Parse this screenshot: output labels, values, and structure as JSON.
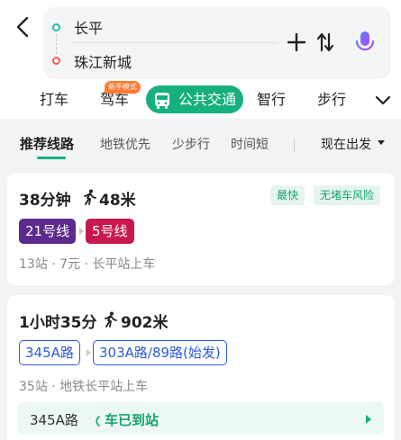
{
  "header": {
    "origin": "长平",
    "destination": "珠江新城"
  },
  "modes": {
    "taxi": "打车",
    "drive": "驾车",
    "drive_badge": "新手模式",
    "transit": "公共交通",
    "smart": "智行",
    "walk": "步行"
  },
  "filters": {
    "recommended": "推荐线路",
    "metro_first": "地铁优先",
    "less_walk": "少步行",
    "short_time": "时间短",
    "departure": "现在出发"
  },
  "routes": [
    {
      "duration": "38分钟",
      "walk": "48米",
      "tags": [
        "最快",
        "无堵车风险"
      ],
      "lines": [
        "21号线",
        "5号线"
      ],
      "info": "13站 · 7元 · 长平站上车"
    },
    {
      "duration": "1小时35分",
      "walk": "902米",
      "lines": [
        "345A路",
        "303A路/89路(始发)"
      ],
      "info": "35站 · 地铁长平站上车",
      "arrival": {
        "route": "345A路",
        "status": "车已到站"
      }
    }
  ],
  "colors": {
    "accent": "#16b07f",
    "line21": "#5c2a8e",
    "line5": "#c8184e",
    "bus": "#2a5bd7"
  }
}
